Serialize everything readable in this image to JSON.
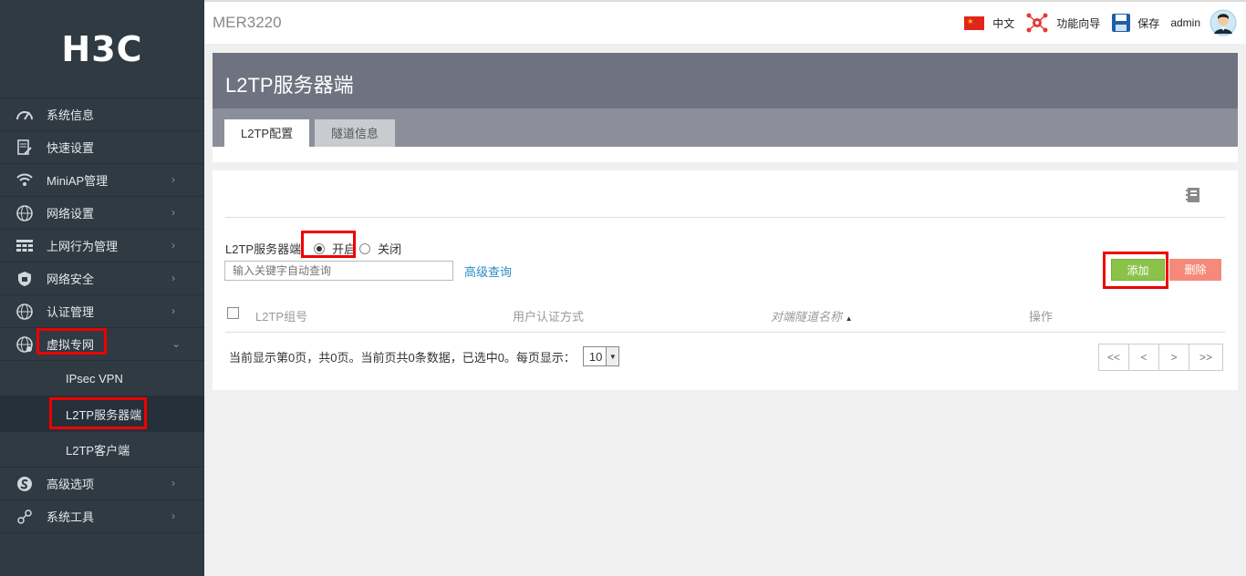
{
  "sidebar": {
    "logo": "H3C",
    "items": [
      {
        "label": "系统信息",
        "icon": "speedometer-icon"
      },
      {
        "label": "快速设置",
        "icon": "quick-setup-icon"
      },
      {
        "label": "MiniAP管理",
        "icon": "wifi-icon"
      },
      {
        "label": "网络设置",
        "icon": "globe-icon"
      },
      {
        "label": "上网行为管理",
        "icon": "behavior-icon"
      },
      {
        "label": "网络安全",
        "icon": "shield-icon"
      },
      {
        "label": "认证管理",
        "icon": "auth-globe-icon"
      },
      {
        "label": "虚拟专网",
        "icon": "vpn-globe-icon"
      },
      {
        "label": "高级选项",
        "icon": "advanced-icon"
      },
      {
        "label": "系统工具",
        "icon": "tools-icon"
      }
    ],
    "sub_items": [
      "IPsec VPN",
      "L2TP服务器端",
      "L2TP客户端"
    ]
  },
  "topbar": {
    "brand": "MER3220",
    "language": "中文",
    "wizard": "功能向导",
    "save": "保存",
    "user": "admin"
  },
  "header": {
    "title": "L2TP服务器端",
    "tabs": [
      "L2TP配置",
      "隧道信息"
    ]
  },
  "form": {
    "server_label": "L2TP服务器端",
    "option_on": "开启",
    "option_off": "关闭",
    "selected": "开启",
    "search_placeholder": "输入关键字自动查询",
    "advanced_search": "高级查询",
    "add_button": "添加",
    "delete_button": "删除"
  },
  "table": {
    "columns": [
      "L2TP组号",
      "用户认证方式",
      "对端隧道名称",
      "操作"
    ],
    "rows": []
  },
  "footer": {
    "status": "当前显示第0页，共0页。当前页共0条数据，已选中0。每页显示：",
    "page_size": "10",
    "pager": [
      "<<",
      "<",
      ">",
      ">>"
    ]
  },
  "colors": {
    "sidebar_bg": "#2f3a43",
    "header_bg": "#6f7280",
    "add_green": "#8bc34a",
    "delete_red": "#f58a7a",
    "highlight_red": "#e00000"
  }
}
